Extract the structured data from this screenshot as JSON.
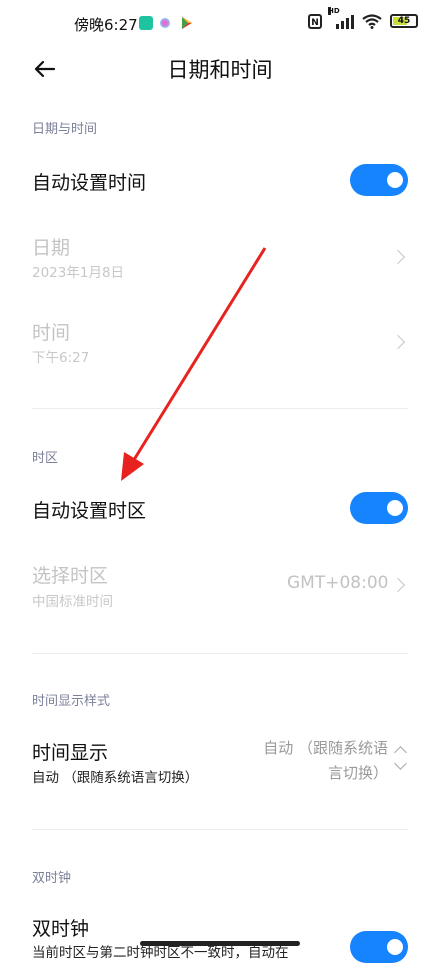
{
  "status_bar": {
    "time": "傍晚6:27",
    "battery_level": "45"
  },
  "header": {
    "title": "日期和时间"
  },
  "sections": {
    "date_time": {
      "header": "日期与时间",
      "auto_time_label": "自动设置时间",
      "auto_time_on": true,
      "date_label": "日期",
      "date_value": "2023年1月8日",
      "time_label": "时间",
      "time_value": "下午6:27"
    },
    "timezone": {
      "header": "时区",
      "auto_tz_label": "自动设置时区",
      "auto_tz_on": true,
      "select_tz_label": "选择时区",
      "select_tz_sub": "中国标准时间",
      "select_tz_value": "GMT+08:00"
    },
    "time_format": {
      "header": "时间显示样式",
      "display_label": "时间显示",
      "display_sub": "自动 （跟随系统语言切换）",
      "display_value_line1": "自动 （跟随系统语",
      "display_value_line2": "言切换）"
    },
    "dual_clock": {
      "header": "双时钟",
      "label": "双时钟",
      "sub": "当前时区与第二时钟时区不一致时，自动在"
    }
  },
  "accent_color": "#1683ff",
  "annotation_color": "#e8231f"
}
